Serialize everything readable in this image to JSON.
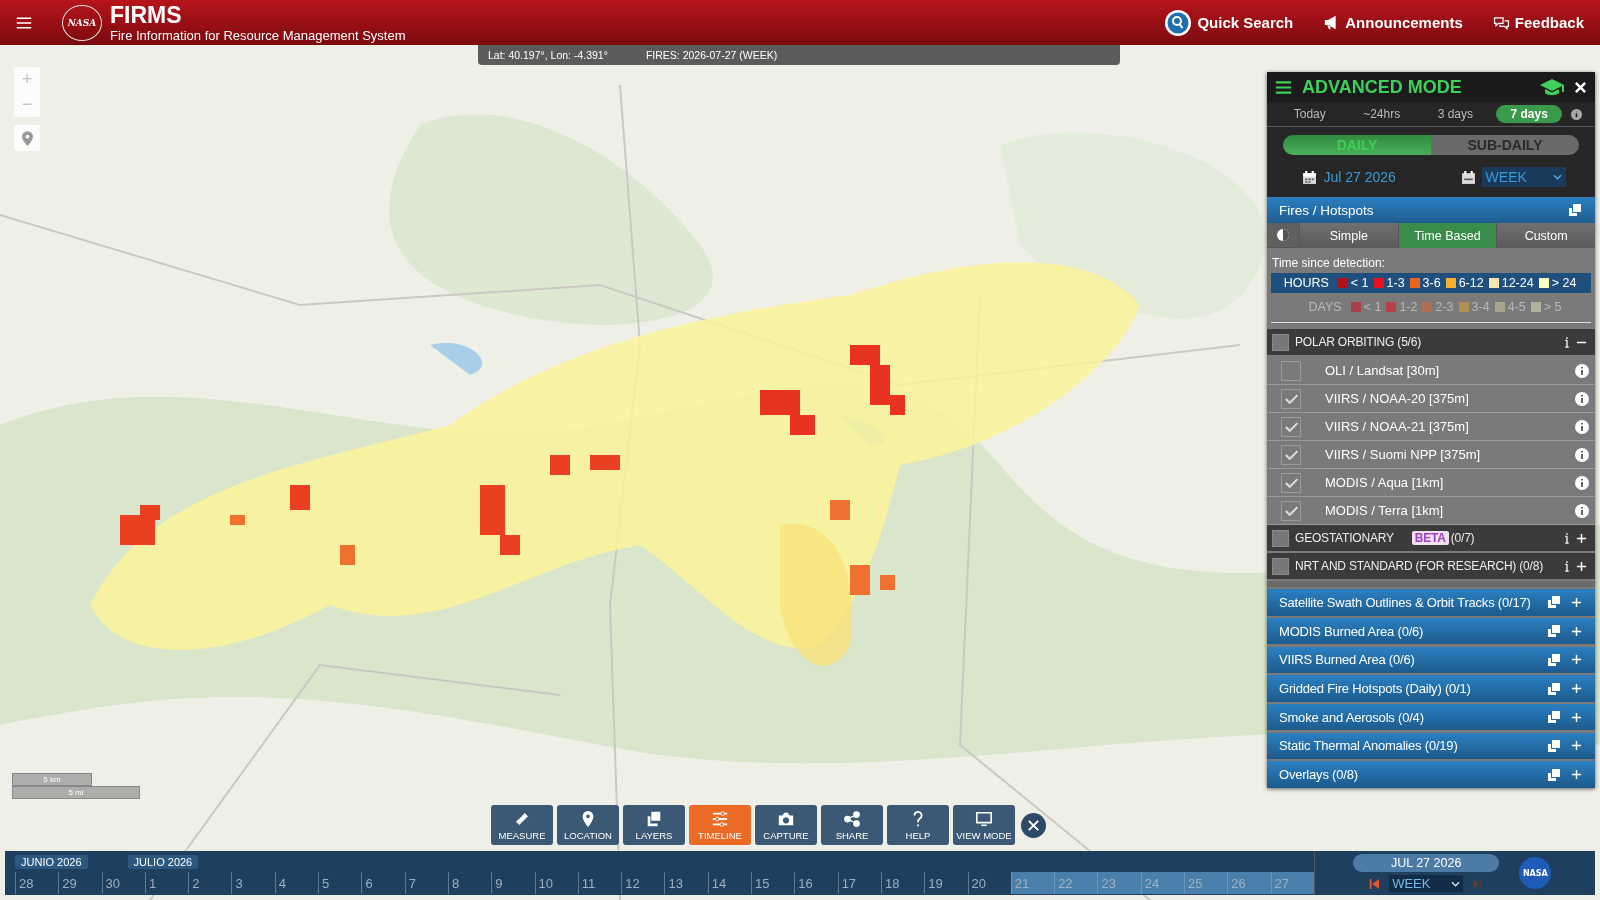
{
  "header": {
    "logo_text": "NASA",
    "title": "FIRMS",
    "subtitle": "Fire Information for Resource Management System",
    "actions": [
      {
        "label": "Quick Search"
      },
      {
        "label": "Announcements"
      },
      {
        "label": "Feedback"
      }
    ]
  },
  "map": {
    "kind": "picture",
    "zoom_controls": [
      "+",
      "−"
    ],
    "scale": [
      "5 km",
      "5 mi"
    ]
  },
  "info_bar": {
    "coords": "Lat: 40.197°, Lon: -4.391°",
    "fires": "FIRES: 2026-07-27 (WEEK)"
  },
  "panel": {
    "title": "ADVANCED MODE",
    "ranges": [
      {
        "label": "Today",
        "selected": false
      },
      {
        "label": "~24hrs",
        "selected": false
      },
      {
        "label": "3 days",
        "selected": false
      },
      {
        "label": "7 days",
        "selected": true
      }
    ],
    "modes": [
      {
        "label": "DAILY",
        "selected": true
      },
      {
        "label": "SUB-DAILY",
        "selected": false
      }
    ],
    "date": "Jul 27 2026",
    "period": "WEEK",
    "fires": {
      "title": "Fires / Hotspots",
      "styles": [
        {
          "label": "Simple",
          "selected": false
        },
        {
          "label": "Time Based",
          "selected": true
        },
        {
          "label": "Custom",
          "selected": false
        }
      ],
      "legend_title": "Time since detection:",
      "hours": {
        "label": "HOURS",
        "items": [
          {
            "label": "< 1",
            "color": "#b0101c"
          },
          {
            "label": "1-3",
            "color": "#e8101e"
          },
          {
            "label": "3-6",
            "color": "#e8641e"
          },
          {
            "label": "6-12",
            "color": "#f5b12e"
          },
          {
            "label": "12-24",
            "color": "#f7e2b4"
          },
          {
            "label": "> 24",
            "color": "#fbfbc4"
          }
        ]
      },
      "days": {
        "label": "DAYS",
        "items": [
          {
            "label": "< 1",
            "color": "#a8404a"
          },
          {
            "label": "1-2",
            "color": "#b8404a"
          },
          {
            "label": "2-3",
            "color": "#b07050"
          },
          {
            "label": "3-4",
            "color": "#b09050"
          },
          {
            "label": "4-5",
            "color": "#aaa28a"
          },
          {
            "label": "> 5",
            "color": "#b2b29a"
          }
        ]
      },
      "groups": [
        {
          "title": "POLAR ORBITING (5/6)",
          "checked": false,
          "expanded": true,
          "sensors": [
            {
              "label": "OLI / Landsat [30m]",
              "checked": false
            },
            {
              "label": "VIIRS / NOAA-20 [375m]",
              "checked": true
            },
            {
              "label": "VIIRS / NOAA-21 [375m]",
              "checked": true
            },
            {
              "label": "VIIRS / Suomi NPP [375m]",
              "checked": true
            },
            {
              "label": "MODIS / Aqua [1km]",
              "checked": true
            },
            {
              "label": "MODIS / Terra [1km]",
              "checked": true
            }
          ]
        },
        {
          "title": "GEOSTATIONARY",
          "badge": "BETA",
          "count": "(0/7)",
          "checked": false,
          "expanded": false
        },
        {
          "title": "NRT AND STANDARD (FOR RESEARCH) (0/8)",
          "checked": false,
          "expanded": false
        }
      ]
    },
    "layers": [
      {
        "label": "Satellite Swath Outlines & Orbit Tracks (0/17)"
      },
      {
        "label": "MODIS Burned Area (0/6)"
      },
      {
        "label": "VIIRS Burned Area (0/6)"
      },
      {
        "label": "Gridded Fire Hotspots (Daily) (0/1)"
      },
      {
        "label": "Smoke and Aerosols (0/4)"
      },
      {
        "label": "Static Thermal Anomalies (0/19)"
      },
      {
        "label": "Overlays (0/8)"
      }
    ]
  },
  "toolbar": [
    {
      "label": "MEASURE",
      "selected": false
    },
    {
      "label": "LOCATION",
      "selected": false
    },
    {
      "label": "LAYERS",
      "selected": false
    },
    {
      "label": "TIMELINE",
      "selected": true
    },
    {
      "label": "CAPTURE",
      "selected": false
    },
    {
      "label": "SHARE",
      "selected": false
    },
    {
      "label": "HELP",
      "selected": false
    },
    {
      "label": "VIEW MODE",
      "selected": false
    }
  ],
  "timeline": {
    "months": [
      {
        "label": "JUNIO 2026"
      },
      {
        "label": "JULIO 2026"
      }
    ],
    "days": [
      {
        "label": "28",
        "selected": false
      },
      {
        "label": "29",
        "selected": false
      },
      {
        "label": "30",
        "selected": false
      },
      {
        "label": "1",
        "selected": false
      },
      {
        "label": "2",
        "selected": false
      },
      {
        "label": "3",
        "selected": false
      },
      {
        "label": "4",
        "selected": false
      },
      {
        "label": "5",
        "selected": false
      },
      {
        "label": "6",
        "selected": false
      },
      {
        "label": "7",
        "selected": false
      },
      {
        "label": "8",
        "selected": false
      },
      {
        "label": "9",
        "selected": false
      },
      {
        "label": "10",
        "selected": false
      },
      {
        "label": "11",
        "selected": false
      },
      {
        "label": "12",
        "selected": false
      },
      {
        "label": "13",
        "selected": false
      },
      {
        "label": "14",
        "selected": false
      },
      {
        "label": "15",
        "selected": false
      },
      {
        "label": "16",
        "selected": false
      },
      {
        "label": "17",
        "selected": false
      },
      {
        "label": "18",
        "selected": false
      },
      {
        "label": "19",
        "selected": false
      },
      {
        "label": "20",
        "selected": false
      },
      {
        "label": "21",
        "selected": true
      },
      {
        "label": "22",
        "selected": true
      },
      {
        "label": "23",
        "selected": true
      },
      {
        "label": "24",
        "selected": true
      },
      {
        "label": "25",
        "selected": true
      },
      {
        "label": "26",
        "selected": true
      },
      {
        "label": "27",
        "selected": true
      }
    ],
    "date": "JUL 27 2026",
    "period": "WEEK",
    "logo_text": "NASA"
  }
}
